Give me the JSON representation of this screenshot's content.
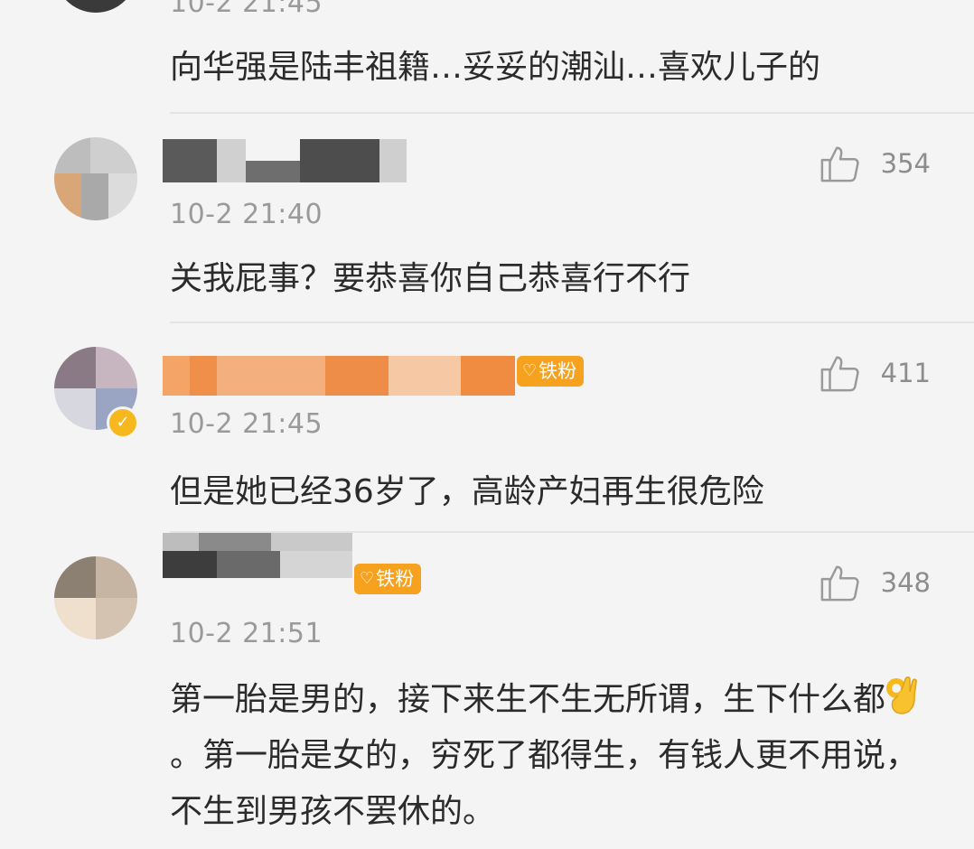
{
  "comments": [
    {
      "time": "10-2 21:45",
      "text": "向华强是陆丰祖籍…妥妥的潮汕…喜欢儿子的"
    },
    {
      "time": "10-2 21:40",
      "text": "关我屁事？要恭喜你自己恭喜行不行",
      "likes": "354"
    },
    {
      "time": "10-2 21:45",
      "text": "但是她已经36岁了，高龄产妇再生很危险",
      "likes": "411",
      "badge": "铁粉"
    },
    {
      "time": "10-2 21:51",
      "text_part1": "第一胎是男的，接下来生不生无所谓，生下什么都",
      "text_part2": "。第一胎是女的，穷死了都得生，有钱人更不用说，不生到男孩不罢休的。",
      "likes": "348",
      "badge": "铁粉"
    }
  ],
  "icons": {
    "like": "thumbs-up-icon",
    "verified": "verified-badge-icon",
    "ok": "ok-hand-emoji"
  },
  "colors": {
    "badge": "#f6a21e",
    "time": "#9a9a9a",
    "text": "#2b2b2b",
    "background": "#f4f4f4"
  }
}
